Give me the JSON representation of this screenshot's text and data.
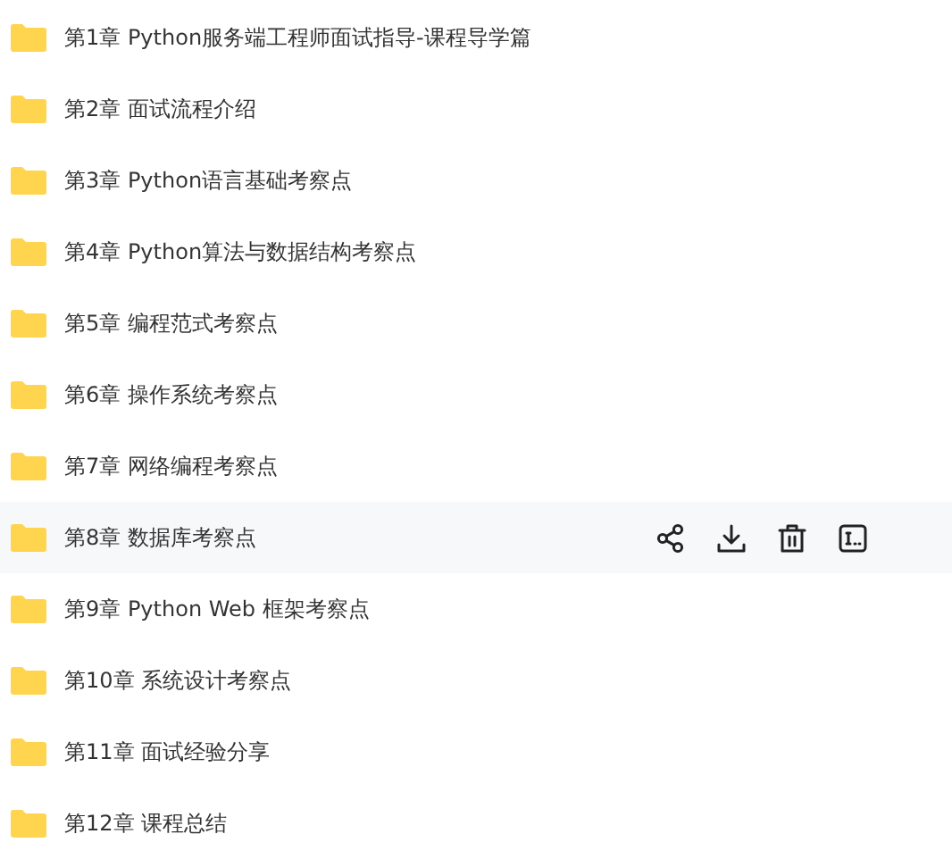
{
  "folders": [
    {
      "name": "第1章 Python服务端工程师面试指导-课程导学篇",
      "selected": false
    },
    {
      "name": "第2章 面试流程介绍",
      "selected": false
    },
    {
      "name": "第3章 Python语言基础考察点",
      "selected": false
    },
    {
      "name": "第4章 Python算法与数据结构考察点",
      "selected": false
    },
    {
      "name": "第5章 编程范式考察点",
      "selected": false
    },
    {
      "name": "第6章 操作系统考察点",
      "selected": false
    },
    {
      "name": "第7章 网络编程考察点",
      "selected": false
    },
    {
      "name": "第8章 数据库考察点",
      "selected": true
    },
    {
      "name": "第9章 Python Web 框架考察点",
      "selected": false
    },
    {
      "name": "第10章 系统设计考察点",
      "selected": false
    },
    {
      "name": "第11章 面试经验分享",
      "selected": false
    },
    {
      "name": "第12章 课程总结",
      "selected": false
    }
  ]
}
